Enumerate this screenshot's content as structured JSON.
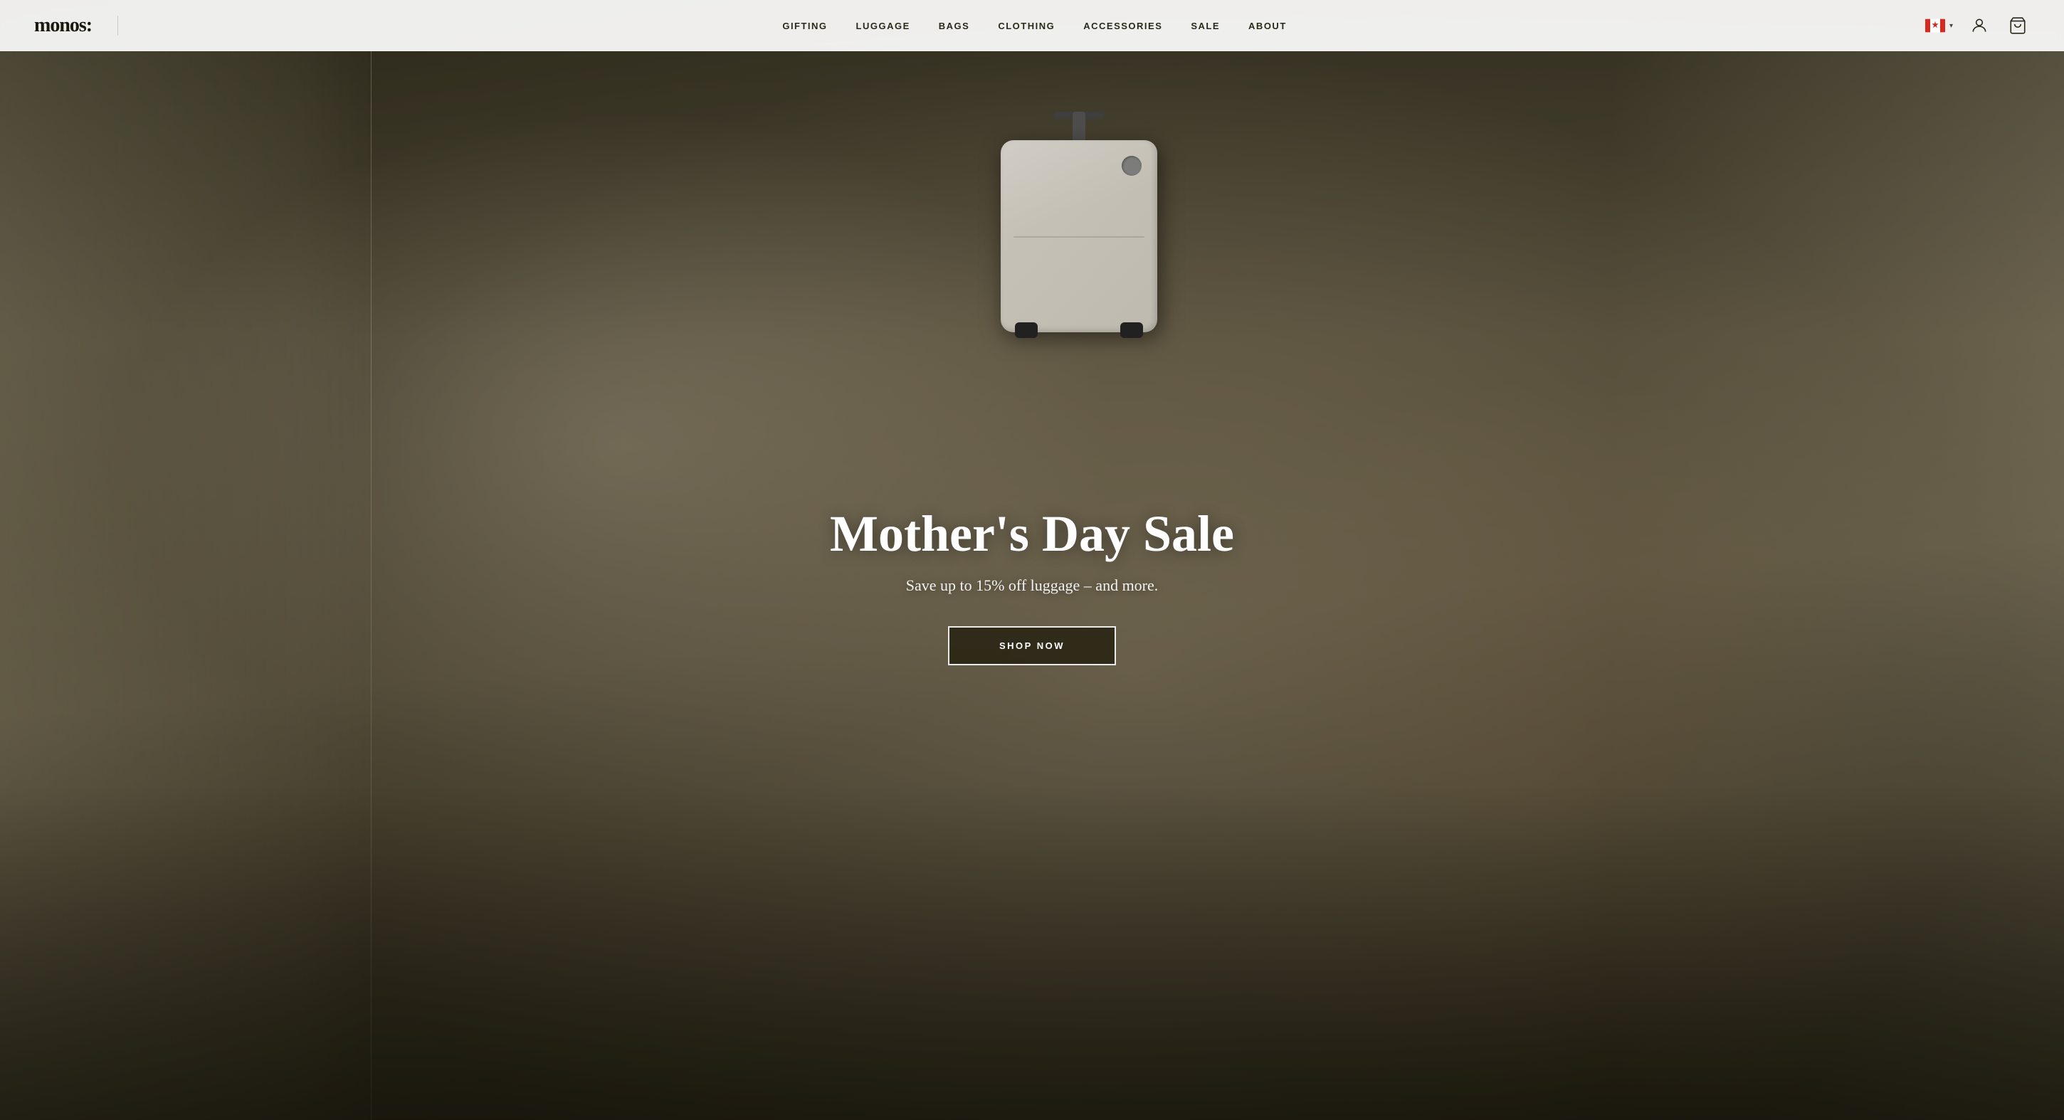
{
  "brand": {
    "name": "monos:",
    "logo_text": "monos:"
  },
  "navbar": {
    "links": [
      {
        "id": "gifting",
        "label": "GIFTING"
      },
      {
        "id": "luggage",
        "label": "LUGGAGE"
      },
      {
        "id": "bags",
        "label": "BAGS"
      },
      {
        "id": "clothing",
        "label": "CLOTHING"
      },
      {
        "id": "accessories",
        "label": "ACCESSORIES"
      },
      {
        "id": "sale",
        "label": "SALE"
      },
      {
        "id": "about",
        "label": "ABOUT"
      }
    ],
    "region": "CA",
    "region_label": "CA"
  },
  "hero": {
    "title": "Mother's Day Sale",
    "subtitle": "Save up to 15% off luggage – and more.",
    "cta_label": "SHOP NOW"
  }
}
